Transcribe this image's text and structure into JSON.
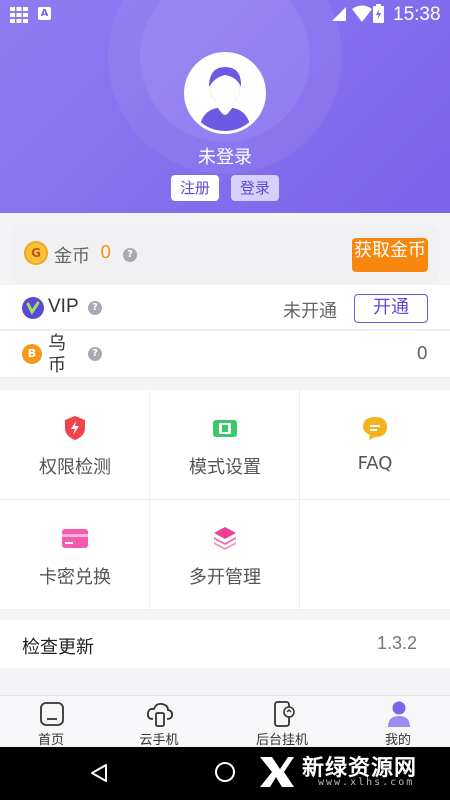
{
  "status_bar": {
    "time": "15:38",
    "notification_letter": "A"
  },
  "profile": {
    "login_status": "未登录",
    "register_label": "注册",
    "login_label": "登录"
  },
  "coins": {
    "icon_letter": "G",
    "label": "金币",
    "value": "0",
    "help": "?",
    "get_label": "获取金币"
  },
  "vip": {
    "label": "VIP",
    "help": "?",
    "status": "未开通",
    "activate_label": "开通"
  },
  "bcoin": {
    "icon_letter": "B",
    "label": "乌币",
    "help": "?",
    "value": "0"
  },
  "features": [
    {
      "label": "权限检测",
      "icon": "shield-icon",
      "color": "#f0444a"
    },
    {
      "label": "模式设置",
      "icon": "mode-icon",
      "color": "#39c96b"
    },
    {
      "label": "FAQ",
      "icon": "chat-icon",
      "color": "#f5b31f"
    },
    {
      "label": "卡密兑换",
      "icon": "card-icon",
      "color": "#f35ab0"
    },
    {
      "label": "多开管理",
      "icon": "layers-icon",
      "color": "#ee3f9b"
    }
  ],
  "update": {
    "label": "检查更新",
    "version": "1.3.2"
  },
  "bottom_nav": [
    {
      "label": "首页",
      "icon": "home-icon"
    },
    {
      "label": "云手机",
      "icon": "cloud-phone-icon"
    },
    {
      "label": "后台挂机",
      "icon": "background-run-icon"
    },
    {
      "label": "我的",
      "icon": "profile-icon",
      "active": true
    }
  ],
  "watermark": {
    "title": "新绿资源网",
    "subtitle": "www.xlhs.com"
  },
  "colors": {
    "brand_purple": "#7b63ea",
    "coin_orange": "#f7870e"
  }
}
